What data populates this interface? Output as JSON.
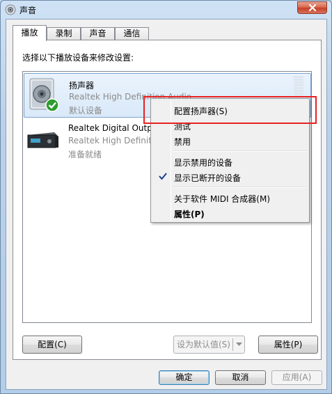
{
  "window": {
    "title": "声音",
    "close_icon": "close-icon",
    "title_icon": "speaker-icon"
  },
  "tabs": [
    {
      "label": "播放",
      "active": true
    },
    {
      "label": "录制",
      "active": false
    },
    {
      "label": "声音",
      "active": false
    },
    {
      "label": "通信",
      "active": false
    }
  ],
  "panel": {
    "instruction": "选择以下播放设备来修改设置:"
  },
  "devices": [
    {
      "name": "扬声器",
      "driver": "Realtek High Definition Audio",
      "status": "默认设备",
      "icon": "speaker-device-icon",
      "selected": true,
      "default_badge": "green-check-icon"
    },
    {
      "name": "Realtek Digital Outp",
      "driver": "Realtek High Definiti",
      "status": "准备就绪",
      "icon": "digital-output-icon",
      "selected": false
    }
  ],
  "context_menu": {
    "items": [
      {
        "label": "配置扬声器(S)"
      },
      {
        "label": "测试"
      },
      {
        "label": "禁用"
      },
      {
        "label": "显示禁用的设备"
      },
      {
        "label": "显示已断开的设备",
        "checked": true
      },
      {
        "label": "关于软件 MIDI 合成器(M)"
      },
      {
        "label": "属性(P)",
        "bold": true
      }
    ]
  },
  "panel_buttons": {
    "configure": "配置(C)",
    "set_default": "设为默认值(S)",
    "properties": "属性(P)"
  },
  "dialog_buttons": {
    "ok": "确定",
    "cancel": "取消",
    "apply": "应用(A)"
  },
  "colors": {
    "highlight_annotation": "#e82020",
    "selection": "#d9e9f9"
  }
}
